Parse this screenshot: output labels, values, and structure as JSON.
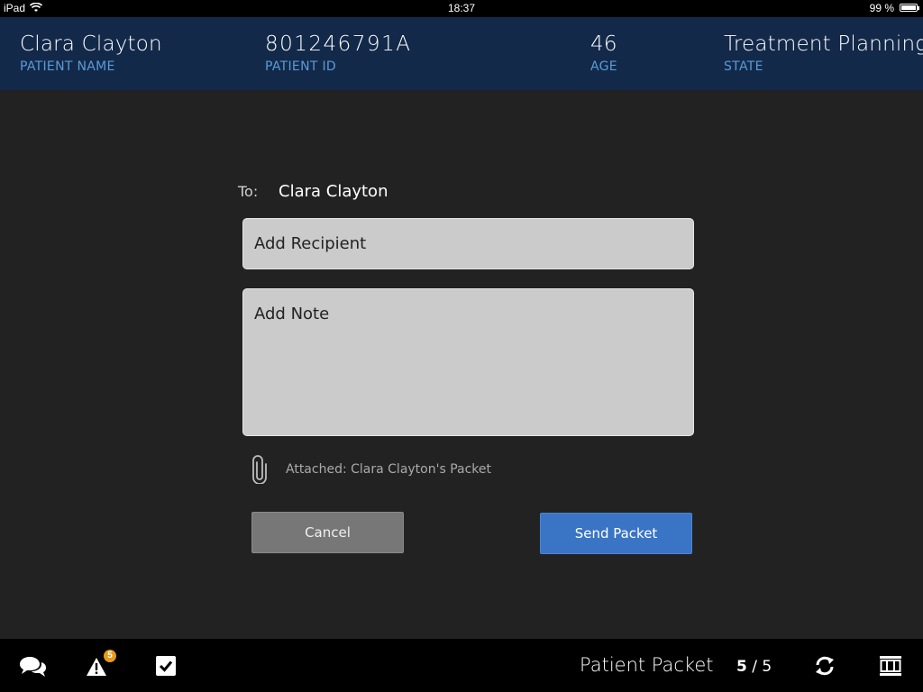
{
  "status_bar": {
    "device": "iPad",
    "time": "18:37",
    "battery": "99 %"
  },
  "patient": {
    "name": "Clara Clayton",
    "name_label": "PATIENT NAME",
    "id": "801246791A",
    "id_label": "PATIENT ID",
    "age": "46",
    "age_label": "AGE",
    "state": "Treatment Planning",
    "state_label": "STATE"
  },
  "compose": {
    "to_label": "To:",
    "to_value": "Clara Clayton",
    "recipient_placeholder": "Add Recipient",
    "note_placeholder": "Add Note",
    "attachment": "Attached: Clara Clayton's Packet",
    "cancel_label": "Cancel",
    "send_label": "Send Packet"
  },
  "bottom_bar": {
    "alert_count": "5",
    "title": "Patient Packet",
    "page_current": "5",
    "page_sep": " / ",
    "page_total": "5",
    "icons": [
      "chat-icon",
      "alert-icon",
      "checkbox-icon",
      "sync-icon",
      "grid-icon"
    ]
  },
  "colors": {
    "header_bg": "#13294a",
    "label_blue": "#5b9bd5",
    "send_button": "#3a74c4",
    "cancel_button": "#777777",
    "badge": "#e89a1c",
    "background": "#222222"
  }
}
